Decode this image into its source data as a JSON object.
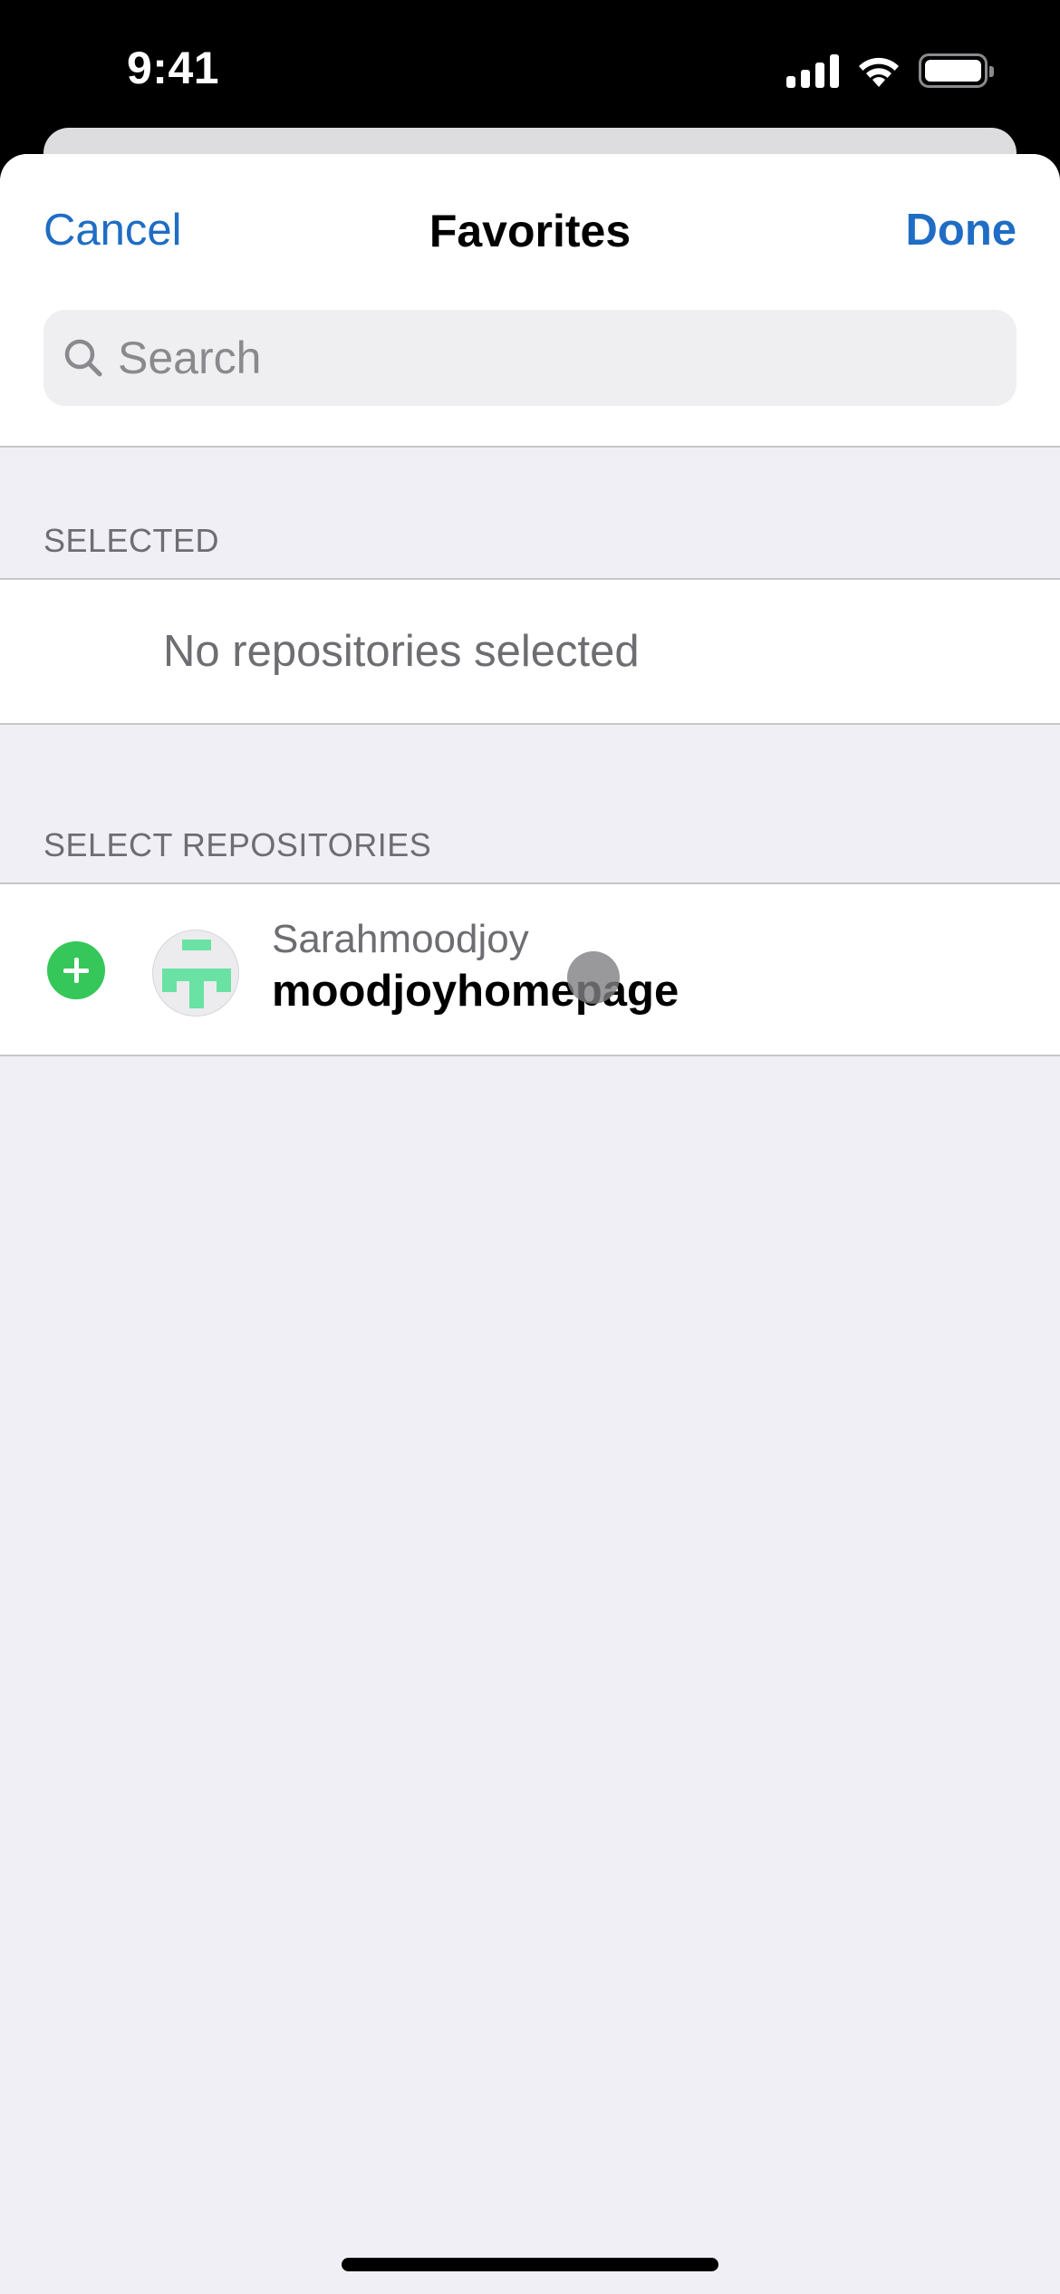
{
  "status_bar": {
    "time": "9:41",
    "icons": [
      "cellular-signal-icon",
      "wifi-icon",
      "battery-icon"
    ]
  },
  "nav": {
    "cancel_label": "Cancel",
    "title": "Favorites",
    "done_label": "Done"
  },
  "search": {
    "placeholder": "Search",
    "value": "",
    "icon": "search-icon"
  },
  "sections": [
    {
      "header": "SELECTED",
      "empty_text": "No repositories selected"
    },
    {
      "header": "SELECT REPOSITORIES",
      "items": [
        {
          "owner": "Sarahmoodjoy",
          "name": "moodjoyhomepage",
          "action_icon": "add-circle-icon",
          "avatar": "identicon-avatar"
        }
      ]
    }
  ],
  "colors": {
    "accent": "#1f6dc4",
    "add_green": "#35c759",
    "identicon": "#6ae2a4",
    "grouped_bg": "#f0eff5",
    "secondary_text": "#6d6d72"
  }
}
